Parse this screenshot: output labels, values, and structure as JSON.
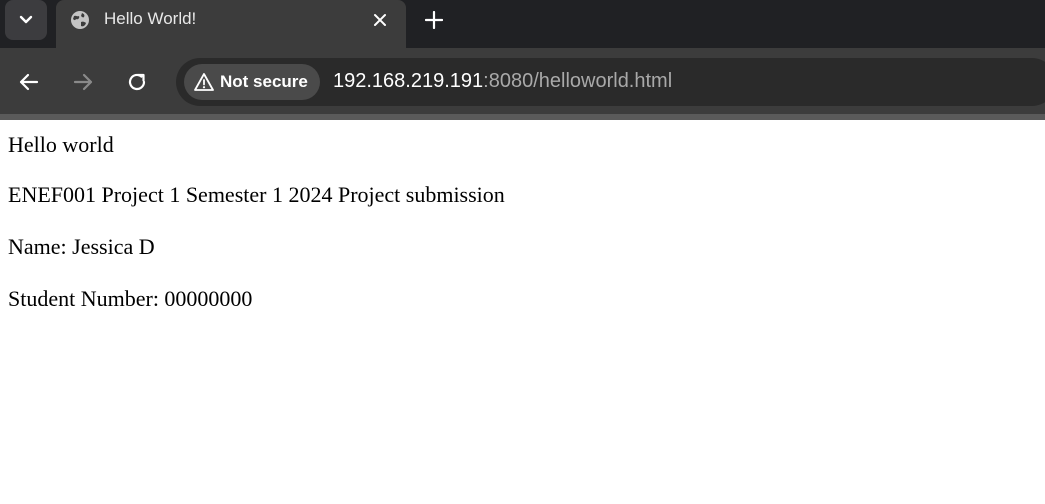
{
  "browser": {
    "tab": {
      "title": "Hello World!"
    },
    "security_label": "Not secure",
    "url": {
      "host": "192.168.219.191",
      "rest": ":8080/helloworld.html"
    },
    "colors": {
      "chrome_dark": "#202124",
      "toolbar": "#3c3c3c",
      "omnibox": "#2a2a2a",
      "chip": "#4a4a4a"
    }
  },
  "page": {
    "lines": [
      "Hello world",
      "ENEF001 Project 1 Semester 1 2024 Project submission",
      "Name: Jessica D",
      "Student Number: 00000000"
    ]
  },
  "icons": {
    "tab_search": "chevron-down-icon",
    "favicon": "globe-icon",
    "close": "close-icon",
    "new_tab": "plus-icon",
    "back": "arrow-left-icon",
    "forward": "arrow-right-icon",
    "reload": "reload-icon",
    "security": "warning-icon"
  }
}
